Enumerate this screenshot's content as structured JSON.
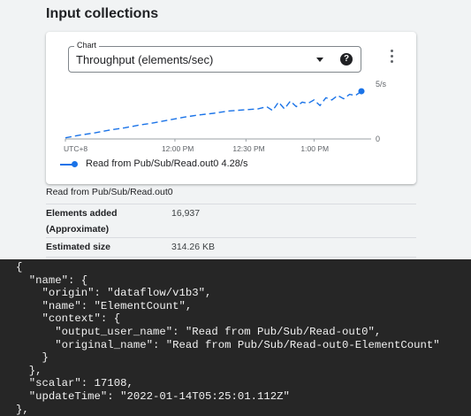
{
  "section": {
    "title": "Input collections"
  },
  "chart_card": {
    "select_legend": "Chart",
    "select_value": "Throughput (elements/sec)",
    "help_icon": "?",
    "more_icon": "more-vert-icon"
  },
  "chart_data": {
    "type": "line",
    "x_ticks": [
      "UTC+8",
      "12:00 PM",
      "12:30 PM",
      "1:00 PM"
    ],
    "y_ticks": [
      "0",
      "5/s"
    ],
    "ylim": [
      0,
      5
    ],
    "y_unit": "/s",
    "series": [
      {
        "name": "Read from Pub/Sub/Read.out0",
        "color": "#1a73e8",
        "style": "dashed",
        "points": [
          [
            0,
            0.1
          ],
          [
            0.05,
            0.35
          ],
          [
            0.1,
            0.55
          ],
          [
            0.15,
            0.8
          ],
          [
            0.2,
            1.0
          ],
          [
            0.25,
            1.25
          ],
          [
            0.3,
            1.45
          ],
          [
            0.35,
            1.7
          ],
          [
            0.4,
            1.95
          ],
          [
            0.45,
            2.15
          ],
          [
            0.5,
            2.3
          ],
          [
            0.55,
            2.5
          ],
          [
            0.6,
            2.6
          ],
          [
            0.65,
            2.7
          ],
          [
            0.68,
            2.9
          ],
          [
            0.7,
            2.55
          ],
          [
            0.72,
            3.3
          ],
          [
            0.74,
            2.7
          ],
          [
            0.76,
            3.4
          ],
          [
            0.78,
            2.9
          ],
          [
            0.8,
            3.3
          ],
          [
            0.82,
            3.2
          ],
          [
            0.84,
            3.5
          ],
          [
            0.86,
            3.0
          ],
          [
            0.88,
            3.7
          ],
          [
            0.9,
            3.5
          ],
          [
            0.92,
            3.9
          ],
          [
            0.94,
            3.6
          ],
          [
            0.96,
            4.0
          ],
          [
            0.98,
            3.9
          ],
          [
            1.0,
            4.28
          ]
        ],
        "last_value": 4.28
      }
    ],
    "legend": [
      {
        "label": "Read from Pub/Sub/Read.out0",
        "value": "4.28/s"
      }
    ]
  },
  "details": {
    "heading": "Read from Pub/Sub/Read.out0",
    "rows": [
      {
        "label_line1": "Elements added",
        "label_line2": "(Approximate)",
        "value": "16,937"
      },
      {
        "label_line1": "Estimated size",
        "label_line2": "",
        "value": "314.26 KB"
      }
    ]
  },
  "console": {
    "lines": [
      "{",
      "  \"name\": {",
      "    \"origin\": \"dataflow/v1b3\",",
      "    \"name\": \"ElementCount\",",
      "    \"context\": {",
      "      \"output_user_name\": \"Read from Pub/Sub/Read-out0\",",
      "      \"original_name\": \"Read from Pub/Sub/Read-out0-ElementCount\"",
      "    }",
      "  },",
      "  \"scalar\": 17108,",
      "  \"updateTime\": \"2022-01-14T05:25:01.112Z\"",
      "},"
    ]
  }
}
